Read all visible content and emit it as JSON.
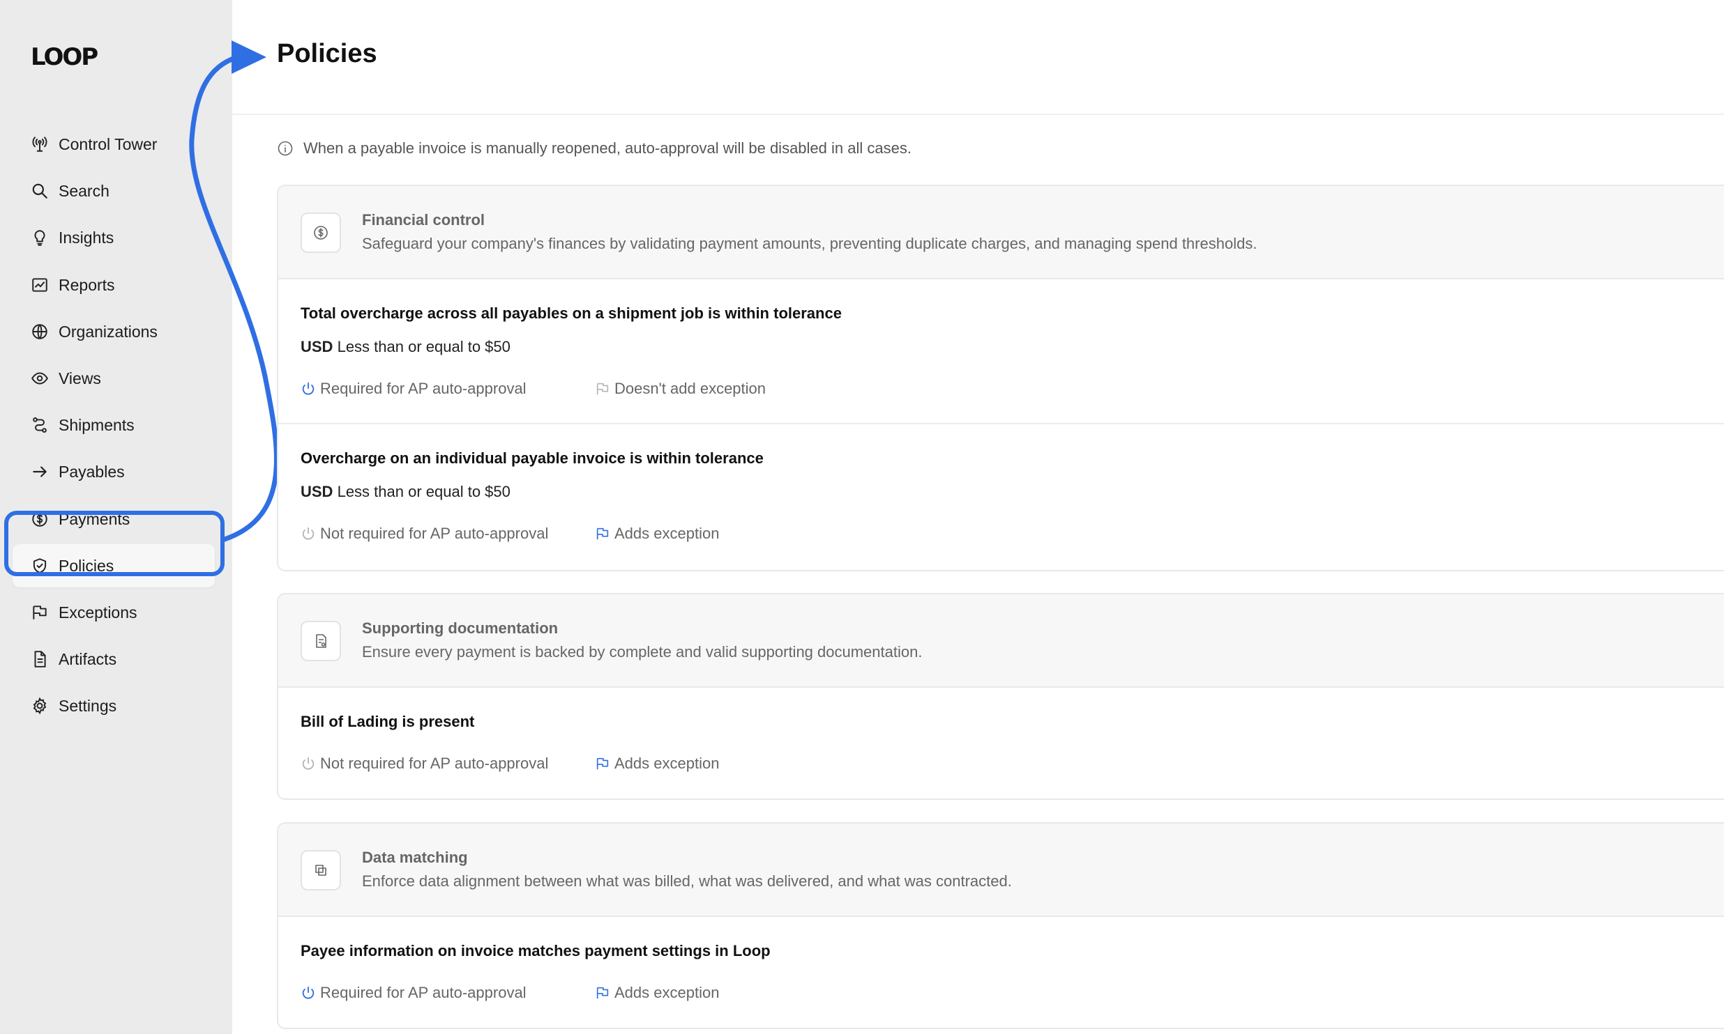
{
  "sidebar": {
    "logo": "LOOP",
    "items": [
      {
        "label": "Control Tower",
        "icon": "antenna-icon"
      },
      {
        "label": "Search",
        "icon": "search-icon"
      },
      {
        "label": "Insights",
        "icon": "lightbulb-icon"
      },
      {
        "label": "Reports",
        "icon": "chart-icon"
      },
      {
        "label": "Organizations",
        "icon": "globe-icon"
      },
      {
        "label": "Views",
        "icon": "eye-icon"
      },
      {
        "label": "Shipments",
        "icon": "route-icon"
      },
      {
        "label": "Payables",
        "icon": "arrow-right-icon"
      },
      {
        "label": "Payments",
        "icon": "dollar-circle-icon"
      },
      {
        "label": "Policies",
        "icon": "shield-check-icon",
        "active": true
      },
      {
        "label": "Exceptions",
        "icon": "flag-icon"
      },
      {
        "label": "Artifacts",
        "icon": "document-icon"
      },
      {
        "label": "Settings",
        "icon": "gear-icon"
      }
    ]
  },
  "main": {
    "title": "Policies",
    "info_note": "When a payable invoice is manually reopened, auto-approval will be disabled in all cases.",
    "categories": [
      {
        "title": "Financial control",
        "description": "Safeguard your company's finances by validating payment amounts, preventing duplicate charges, and managing spend thresholds.",
        "icon": "dollar-circle-icon",
        "rules": [
          {
            "title": "Total overcharge across all payables on a shipment job is within tolerance",
            "currency": "USD",
            "condition": "Less than or equal to $50",
            "approval": "Required for AP auto-approval",
            "approval_required": true,
            "exception": "Doesn't add exception",
            "adds_exception": false
          },
          {
            "title": "Overcharge on an individual payable invoice is within tolerance",
            "currency": "USD",
            "condition": "Less than or equal to $50",
            "approval": "Not required for AP auto-approval",
            "approval_required": false,
            "exception": "Adds exception",
            "adds_exception": true
          }
        ]
      },
      {
        "title": "Supporting documentation",
        "description": "Ensure every payment is backed by complete and valid supporting documentation.",
        "icon": "document-check-icon",
        "rules": [
          {
            "title": "Bill of Lading is present",
            "approval": "Not required for AP auto-approval",
            "approval_required": false,
            "exception": "Adds exception",
            "adds_exception": true
          }
        ]
      },
      {
        "title": "Data matching",
        "description": "Enforce data alignment between what was billed, what was delivered, and what was contracted.",
        "icon": "overlap-squares-icon",
        "rules": [
          {
            "title": "Payee information on invoice matches payment settings in Loop",
            "approval": "Required for AP auto-approval",
            "approval_required": true,
            "exception": "Adds exception",
            "adds_exception": true
          }
        ]
      }
    ]
  },
  "colors": {
    "accent": "#2f6fe3",
    "sidebar_bg": "#ebebeb",
    "muted_text": "#666666"
  }
}
